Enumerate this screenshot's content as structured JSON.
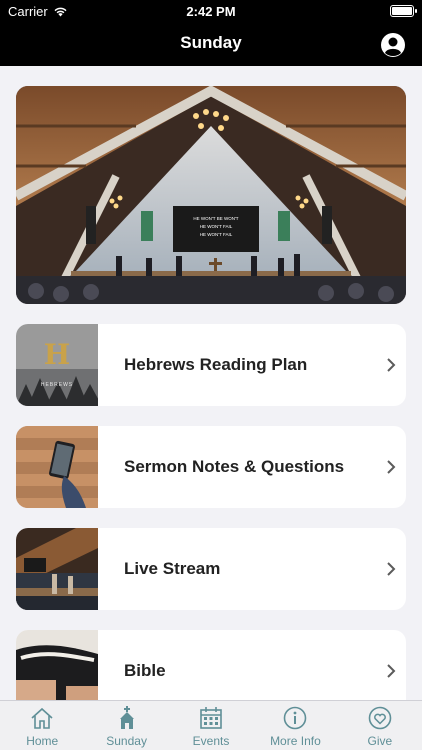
{
  "status": {
    "carrier": "Carrier",
    "time": "2:42 PM"
  },
  "nav": {
    "title": "Sunday",
    "profile_icon": "person-circle-icon"
  },
  "hero": {
    "alt_subject": "church-worship-photo",
    "screen_lines": [
      "HE WON'T BE WON'T",
      "HE WON'T FAIL",
      "HE WON'T FAIL"
    ]
  },
  "cards": [
    {
      "label": "Hebrews Reading Plan",
      "thumb_text": "HEBREWS"
    },
    {
      "label": "Sermon Notes & Questions"
    },
    {
      "label": "Live Stream"
    },
    {
      "label": "Bible"
    }
  ],
  "tabs": [
    {
      "label": "Home",
      "icon": "home-icon",
      "active": false
    },
    {
      "label": "Sunday",
      "icon": "church-icon",
      "active": true
    },
    {
      "label": "Events",
      "icon": "calendar-icon",
      "active": false
    },
    {
      "label": "More Info",
      "icon": "info-icon",
      "active": false
    },
    {
      "label": "Give",
      "icon": "heart-icon",
      "active": false
    }
  ],
  "colors": {
    "accent": "#5f8f97",
    "topbar": "#000000",
    "background": "#f2f2f6"
  }
}
